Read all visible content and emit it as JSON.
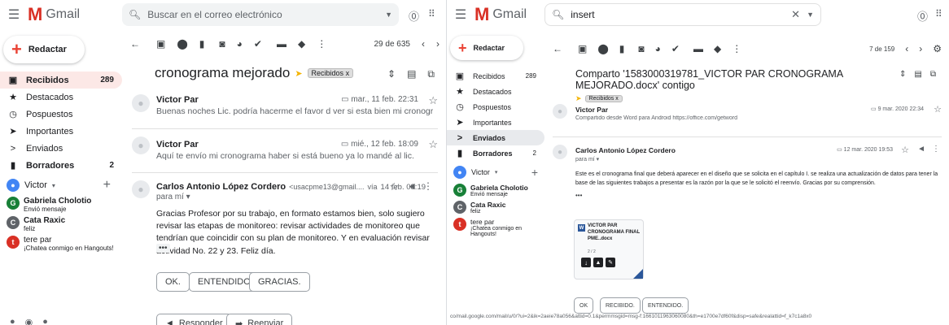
{
  "left": {
    "app_name": "Gmail",
    "search_placeholder": "Buscar en el correo electrónico",
    "compose_label": "Redactar",
    "nav": [
      {
        "label": "Recibidos",
        "count": "289",
        "icon": "inbox-icon"
      },
      {
        "label": "Destacados",
        "count": "",
        "icon": "star-icon"
      },
      {
        "label": "Pospuestos",
        "count": "",
        "icon": "clock-icon"
      },
      {
        "label": "Importantes",
        "count": "",
        "icon": "important-icon"
      },
      {
        "label": "Enviados",
        "count": "",
        "icon": "send-icon"
      },
      {
        "label": "Borradores",
        "count": "2",
        "icon": "draft-icon"
      }
    ],
    "chat_user": "Victor",
    "chats": [
      {
        "name": "Gabriela Cholotio",
        "status": "Envió mensaje",
        "color": "#188038",
        "initial": "G"
      },
      {
        "name": "Cata Raxic",
        "status": "feliz",
        "color": "#5f6368",
        "initial": "C"
      },
      {
        "name": "tere par",
        "status": "¡Chatea conmigo en Hangouts!",
        "color": "#d93025",
        "initial": "t"
      }
    ],
    "pager": "29 de 635",
    "subject": "cronograma mejorado",
    "label": "Recibidos",
    "messages": [
      {
        "sender": "Victor Par",
        "date": "mar., 11 feb. 22:31",
        "snippet": "Buenas noches Lic. podría hacerme el favor d ver si esta bien mi cronograma, le agradec..."
      },
      {
        "sender": "Victor Par",
        "date": "mié., 12 feb. 18:09",
        "snippet": "Aquí te envío mi cronograma haber si está bueno ya lo mandé al lic."
      }
    ],
    "open_message": {
      "sender": "Carlos Antonio López Cordero",
      "email": "<usacpme13@gmail....",
      "via": "vía",
      "date": "14 feb. 08:19",
      "to": "para mí",
      "body": "Gracias Profesor por su trabajo, en formato estamos bien, solo sugiero revisar las etapas de monitoreo: revisar actividades de monitoreo que tendrían que coincidir con su plan de monitoreo. Y en evaluación revisar actividad No. 22 y 23. Feliz día."
    },
    "smart_replies": [
      "OK.",
      "ENTENDIDO.",
      "GRACIAS."
    ],
    "reply_label": "Responder",
    "forward_label": "Reenviar"
  },
  "right": {
    "app_name": "Gmail",
    "search_value": "insert",
    "compose_label": "Redactar",
    "nav": [
      {
        "label": "Recibidos",
        "count": "289",
        "icon": "inbox-icon"
      },
      {
        "label": "Destacados",
        "count": "",
        "icon": "star-icon"
      },
      {
        "label": "Pospuestos",
        "count": "",
        "icon": "clock-icon"
      },
      {
        "label": "Importantes",
        "count": "",
        "icon": "important-icon"
      },
      {
        "label": "Enviados",
        "count": "",
        "icon": "send-icon"
      },
      {
        "label": "Borradores",
        "count": "2",
        "icon": "draft-icon"
      }
    ],
    "chat_user": "Victor",
    "chats": [
      {
        "name": "Gabriela Cholotio",
        "status": "Envió mensaje",
        "color": "#188038",
        "initial": "G"
      },
      {
        "name": "Cata Raxic",
        "status": "feliz",
        "color": "#5f6368",
        "initial": "C"
      },
      {
        "name": "tere par",
        "status": "¡Chatea conmigo en Hangouts!",
        "color": "#d93025",
        "initial": "t"
      }
    ],
    "pager": "7 de 159",
    "subject": "Comparto '1583000319781_VICTOR PAR CRONOGRAMA MEJORADO.docx' contigo",
    "label": "Recibidos",
    "message1": {
      "sender": "Victor Par",
      "date": "9 mar. 2020 22:34",
      "snippet": "Compartido desde Word para Android https://office.com/getword"
    },
    "message2": {
      "sender": "Carlos Antonio López Cordero",
      "date": "12 mar. 2020 19:53",
      "to": "para mí",
      "body": "Este es el cronograma final que deberá aparecer en el diseño que se solicita en el capítulo I. se realiza una actualización de datos para tener la base de las siguientes trabajos a presentar es la razón por la que se le solicitó el reenvío. Gracias por su comprensión."
    },
    "attachment_title": "VICTOR PAR CRONOGRAMA FINAL PME..docx",
    "attachment_pages": "2 / 2",
    "smart_replies": [
      "OK",
      "RECIBIDO.",
      "ENTENDIDO."
    ],
    "status_url": "co/mail.google.com/mail/u/0/?ui=2&ik=2aeie78a056&attid=0.1&permmsgid=msg-f:1661011963060080&th=e1700e7df60f&disp=safe&realattid=f_k7c1a8x0"
  },
  "colors": {
    "accent_red": "#d93025",
    "inbox_bg": "#fce8e6",
    "compose_plus": "#ea4335"
  }
}
